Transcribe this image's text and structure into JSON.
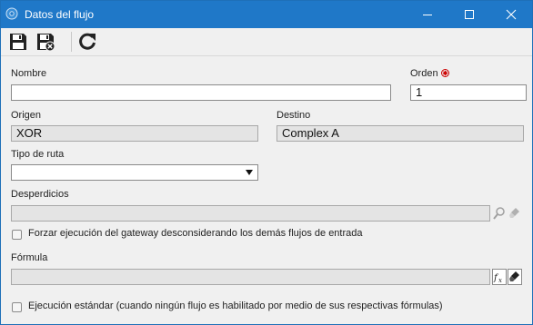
{
  "window": {
    "title": "Datos del flujo"
  },
  "form": {
    "nombre": {
      "label": "Nombre",
      "value": ""
    },
    "orden": {
      "label": "Orden",
      "value": "1"
    },
    "origen": {
      "label": "Origen",
      "value": "XOR"
    },
    "destino": {
      "label": "Destino",
      "value": "Complex A"
    },
    "tipo_ruta": {
      "label": "Tipo de ruta",
      "value": ""
    },
    "desperdicios": {
      "label": "Desperdicios",
      "value": ""
    },
    "forzar": {
      "label": "Forzar ejecución del gateway desconsiderando los demás flujos de entrada",
      "checked": false
    },
    "formula": {
      "label": "Fórmula",
      "value": ""
    },
    "ejecucion": {
      "label": "Ejecución estándar (cuando ningún flujo es habilitado por medio de sus respectivas fórmulas)",
      "checked": false
    }
  },
  "colors": {
    "titlebar": "#1f78c8",
    "required": "#cc0000"
  }
}
